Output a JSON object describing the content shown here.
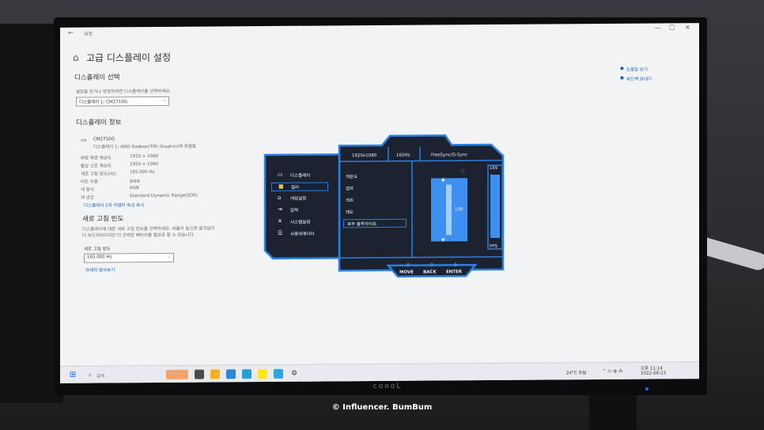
{
  "window": {
    "back": "←",
    "title": "설정",
    "minimize": "—",
    "maximize": "☐",
    "close": "✕"
  },
  "page": {
    "title": "고급 디스플레이 설정"
  },
  "side_links": {
    "help": "도움말 보기",
    "feedback": "피드백 보내기"
  },
  "display_select": {
    "heading": "디스플레이 선택",
    "desc": "설정을 보거나 변경하려면 디스플레이를 선택하세요.",
    "value": "디스플레이 1: CM2710G"
  },
  "display_info": {
    "heading": "디스플레이 정보",
    "monitor_name": "CM2710G",
    "monitor_conn": "디스플레이 1: AMD Radeon(TM) Graphics에 연결됨",
    "rows": [
      {
        "label": "바탕 화면 해상도",
        "value": "1920 × 1080"
      },
      {
        "label": "활성 신호 해상도",
        "value": "1920 × 1080"
      },
      {
        "label": "새로 고침 빈도(Hz)",
        "value": "165.000 Hz"
      },
      {
        "label": "비트 수준",
        "value": "8비트"
      },
      {
        "label": "색 형식",
        "value": "RGB"
      },
      {
        "label": "색 공간",
        "value": "Standard Dynamic Range(SDR)"
      }
    ],
    "adapter_link": "디스플레이 1의 어댑터 속성 표시"
  },
  "refresh": {
    "heading": "새로 고침 빈도",
    "desc1": "디스플레이에 대한 새로 고침 빈도를 선택하세요. 비율이 높으면 움직임이",
    "desc2": "더 부드러워지지만 더 강력한 배터리를 필요로 할 수 있습니다.",
    "field_label": "새로 고침 빈도",
    "value": "165.000 Hz",
    "more_link": "자세히 알아보기"
  },
  "osd": {
    "resolution": "1920x1080",
    "refresh": "165Hz",
    "sync": "FreeSync/G-Sync",
    "fps_value": "165",
    "fps_label": "FPS",
    "menu": [
      {
        "icon": "▭",
        "label": "디스플레이"
      },
      {
        "icon": "■",
        "label": "컬러"
      },
      {
        "icon": "⌂",
        "label": "게임설정"
      },
      {
        "icon": "⇥",
        "label": "입력"
      },
      {
        "icon": "✕",
        "label": "시스템설정"
      },
      {
        "icon": "☰",
        "label": "사용자메이터"
      }
    ],
    "submenu": [
      "색온도",
      "감마",
      "색조",
      "채도",
      "로우 블루라이트"
    ],
    "slider_value": "100",
    "slider_level": 1.0,
    "buttons": [
      "MOVE",
      "BACK",
      "ENTER"
    ]
  },
  "taskbar": {
    "search": "검색",
    "weather": "24°C 흐림",
    "clock_time": "오후 11:14",
    "clock_date": "2022-08-23"
  },
  "bezel_logo": "coooL",
  "watermark": "© Influencer. BumBum",
  "colors": {
    "osd_blue": "#2a7fe0",
    "osd_dark": "#1c2230",
    "link": "#1a5fb4"
  }
}
